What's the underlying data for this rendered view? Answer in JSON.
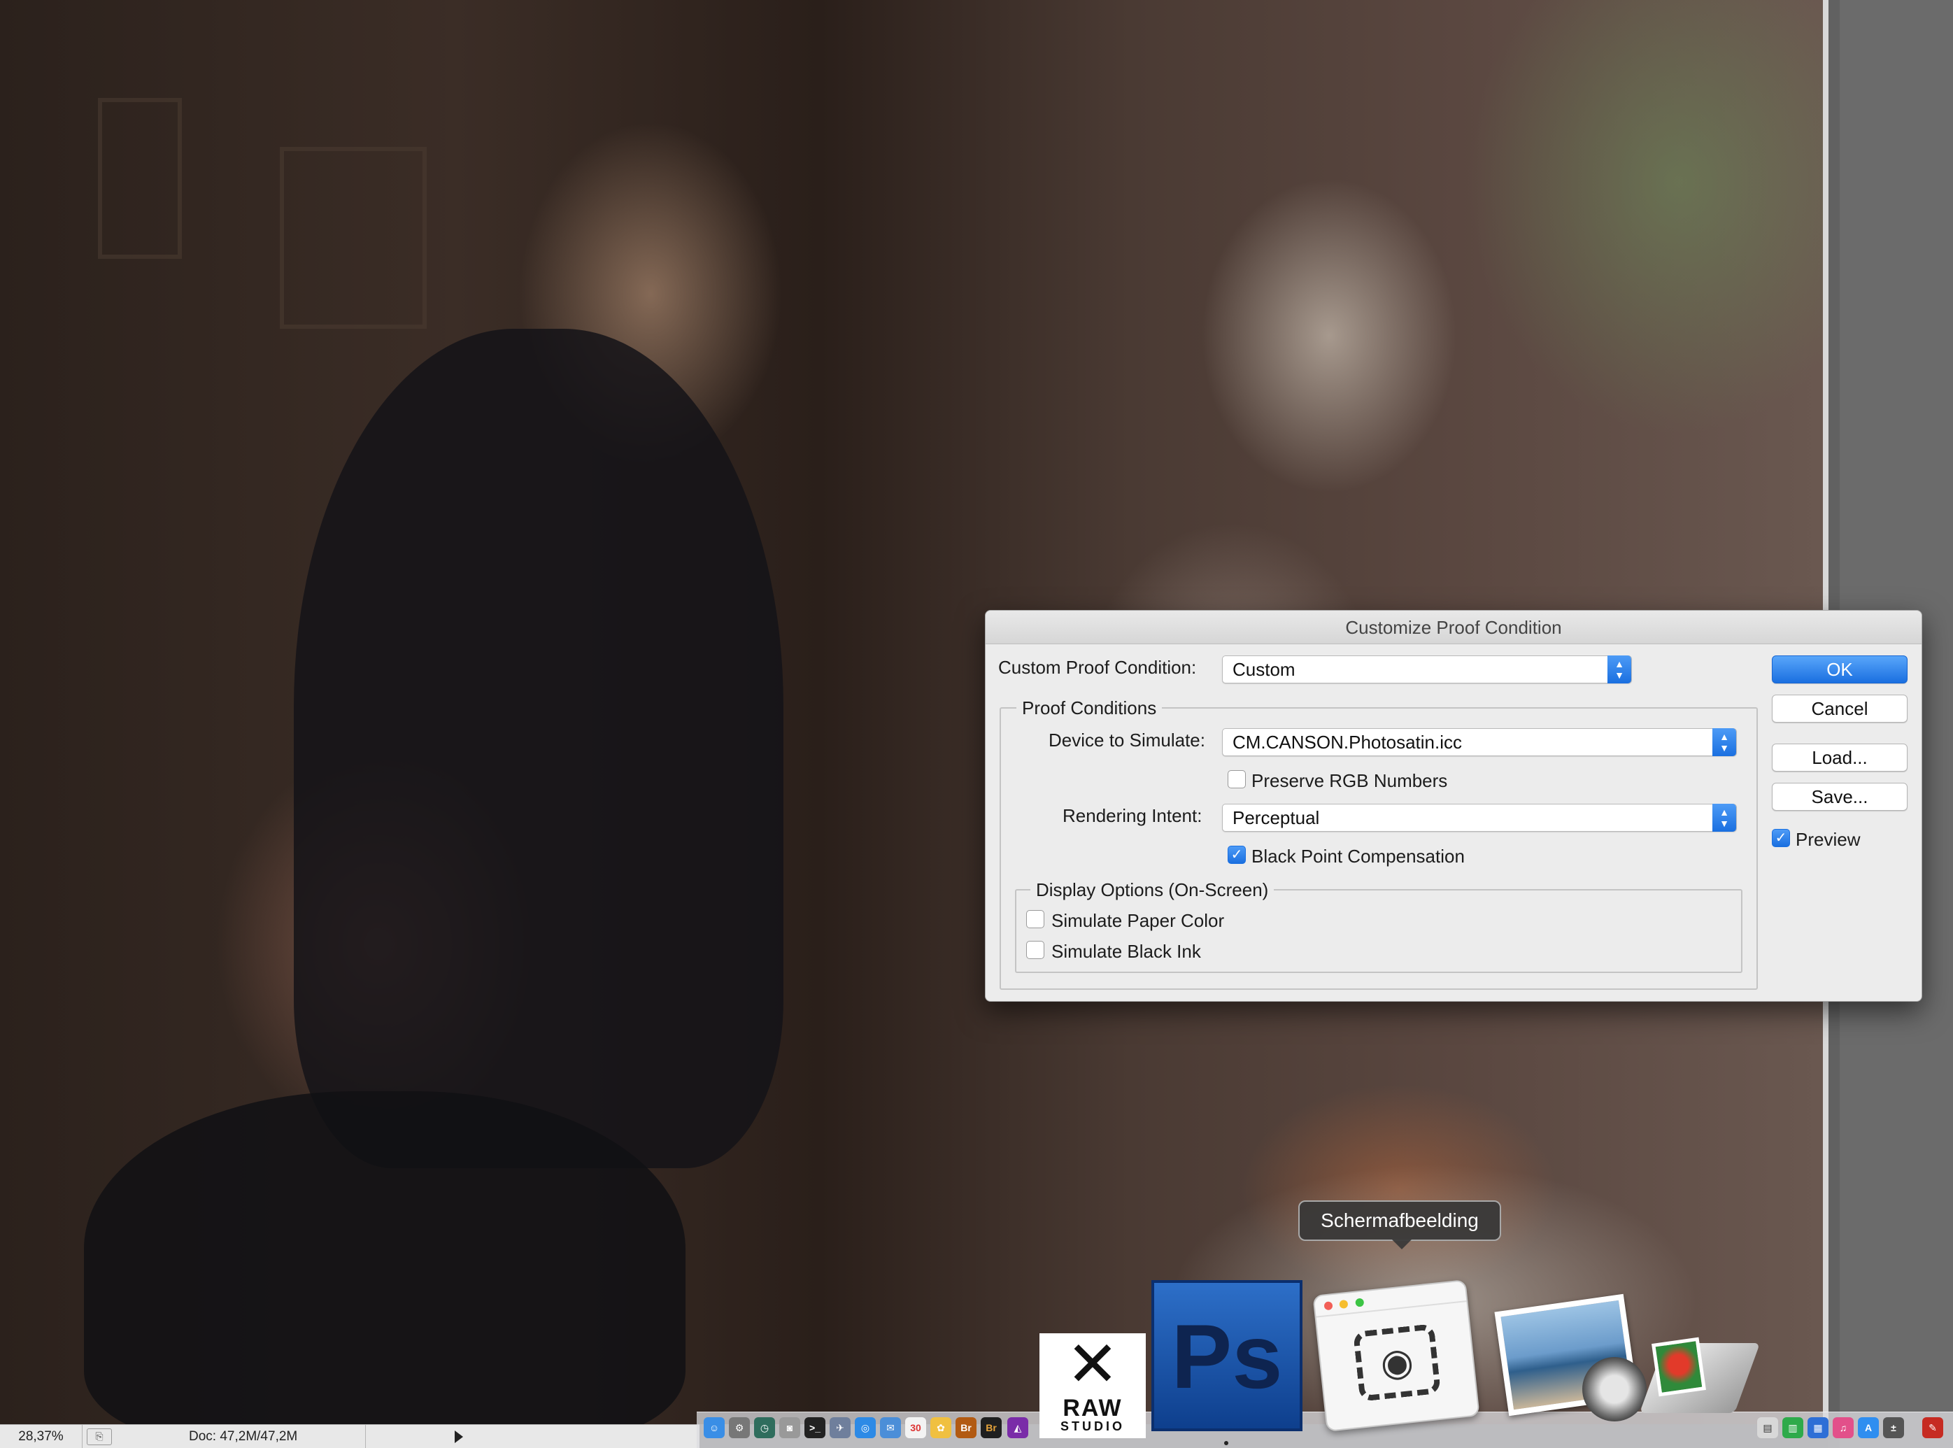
{
  "dialog": {
    "title": "Customize Proof Condition",
    "custom_condition_label": "Custom Proof Condition:",
    "custom_condition_value": "Custom",
    "proof_conditions_group": "Proof Conditions",
    "device_label": "Device to Simulate:",
    "device_value": "CM.CANSON.Photosatin.icc",
    "preserve_rgb_label": "Preserve RGB Numbers",
    "preserve_rgb_checked": false,
    "rendering_label": "Rendering Intent:",
    "rendering_value": "Perceptual",
    "bpc_label": "Black Point Compensation",
    "bpc_checked": true,
    "display_group": "Display Options (On-Screen)",
    "paper_color_label": "Simulate Paper Color",
    "paper_color_checked": false,
    "black_ink_label": "Simulate Black Ink",
    "black_ink_checked": false,
    "ok": "OK",
    "cancel": "Cancel",
    "load": "Load...",
    "save": "Save...",
    "preview_label": "Preview",
    "preview_checked": true,
    "accent_color": "#1a6fe0"
  },
  "status": {
    "zoom": "28,37%",
    "doc_size": "Doc: 47,2M/47,2M"
  },
  "dock": {
    "tooltip": "Schermafbeelding",
    "ps_label": "Ps",
    "raw_label": "RAW",
    "raw_studio_label": "STUDIO",
    "bridge_label": "Br",
    "apps": [
      "finder-icon",
      "safari-icon",
      "photoshop-icon",
      "screenshot-icon",
      "preview-icon",
      "image-capture-icon"
    ]
  }
}
